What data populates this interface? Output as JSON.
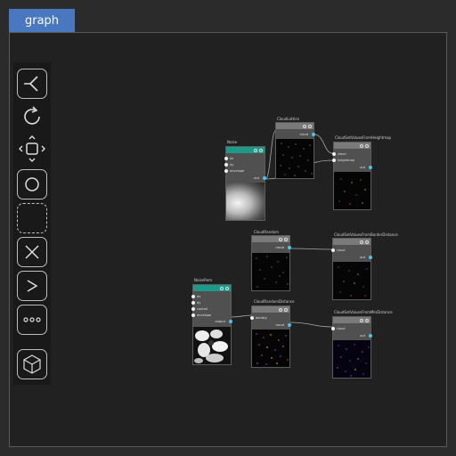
{
  "tab": {
    "label": "graph"
  },
  "nodes": {
    "noise": {
      "title": "Noise",
      "inputs": [
        "dx",
        "dy",
        "envelope"
      ],
      "output": "out"
    },
    "noise_rem": {
      "title": "NoiseRem",
      "inputs": [
        "dx",
        "dy",
        "control",
        "envelope"
      ],
      "output": "output"
    },
    "cloud_lattice": {
      "title": "CloudLattice",
      "output": "cloud"
    },
    "cloud_set_heightmap": {
      "title": "CloudSetValuesFromHeightmap",
      "inputs": [
        "cloud",
        "heightmap"
      ],
      "output": "out"
    },
    "cloud_random": {
      "title": "CloudRandom",
      "output": "cloud"
    },
    "cloud_set_border": {
      "title": "CloudSetValuesFromBorderDistance",
      "inputs": [
        "cloud"
      ],
      "output": "out"
    },
    "cloud_random_distance": {
      "title": "CloudRandomDistance",
      "inputs": [
        "density"
      ],
      "output": "cloud"
    },
    "cloud_set_min_distance": {
      "title": "CloudSetValuesFromMinDistance",
      "inputs": [
        "cloud"
      ],
      "output": "out"
    }
  },
  "colors": {
    "accent_tab": "#4a78c0",
    "node_header_teal": "#1e9a8a",
    "node_header_gray": "#7a7a7a",
    "output_port": "#4fc3e8"
  }
}
